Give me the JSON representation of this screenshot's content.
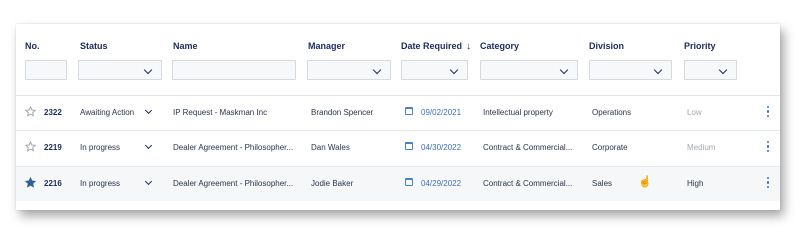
{
  "columns": {
    "no": "No.",
    "status": "Status",
    "name": "Name",
    "manager": "Manager",
    "date_required": "Date Required",
    "category": "Category",
    "division": "Division",
    "priority": "Priority"
  },
  "sort": {
    "column": "date_required",
    "direction": "desc",
    "icon": "arrow-down-icon"
  },
  "filters": {
    "no": "",
    "status": "",
    "name": "",
    "manager": "",
    "date_required": "",
    "category": "",
    "division": "",
    "priority": ""
  },
  "rows": [
    {
      "starred": false,
      "no": "2322",
      "status": "Awaiting Action",
      "name": "IP Request - Maskman Inc",
      "manager": "Brandon Spencer",
      "date": "09/02/2021",
      "category": "Intellectual property",
      "division": "Operations",
      "priority": "Low"
    },
    {
      "starred": false,
      "no": "2219",
      "status": "In progress",
      "name": "Dealer Agreement - Philosopher...",
      "manager": "Dan Wales",
      "date": "04/30/2022",
      "category": "Contract & Commercial...",
      "division": "Corporate",
      "priority": "Medium"
    },
    {
      "starred": true,
      "no": "2216",
      "status": "In progress",
      "name": "Dealer Agreement - Philosopher...",
      "manager": "Jodie Baker",
      "date": "04/29/2022",
      "category": "Contract & Commercial...",
      "division": "Sales",
      "priority": "High"
    }
  ],
  "colors": {
    "header_text": "#1d2b5a",
    "date_link": "#3f6fb5",
    "star_filled": "#2f5f9e",
    "star_outline": "#9aa0ab",
    "muted_priority": "#a3a8b3"
  }
}
